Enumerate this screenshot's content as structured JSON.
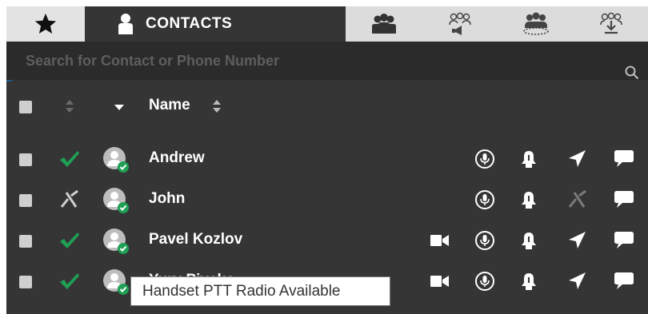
{
  "tabs": {
    "favorites": "favorites-star-icon",
    "contacts_label": "CONTACTS",
    "others": [
      "group-icon",
      "broadcast-group-icon",
      "dynamic-group-icon",
      "download-group-icon"
    ]
  },
  "search": {
    "placeholder": "Search for Contact or Phone Number",
    "value": ""
  },
  "header": {
    "name_label": "Name"
  },
  "contacts": [
    {
      "name": "Andrew",
      "status": "available",
      "video": false
    },
    {
      "name": "John",
      "status": "unavailable",
      "video": false
    },
    {
      "name": "Pavel Kozlov",
      "status": "available",
      "video": true
    },
    {
      "name": "Yury Pivako",
      "status": "available",
      "video": true
    }
  ],
  "tooltip": {
    "text": "Handset PTT Radio Available"
  },
  "colors": {
    "background": "#353535",
    "available_green": "#1fa055",
    "accent_blue": "#1f5f94",
    "tab_inactive": "#dcdcdc"
  }
}
